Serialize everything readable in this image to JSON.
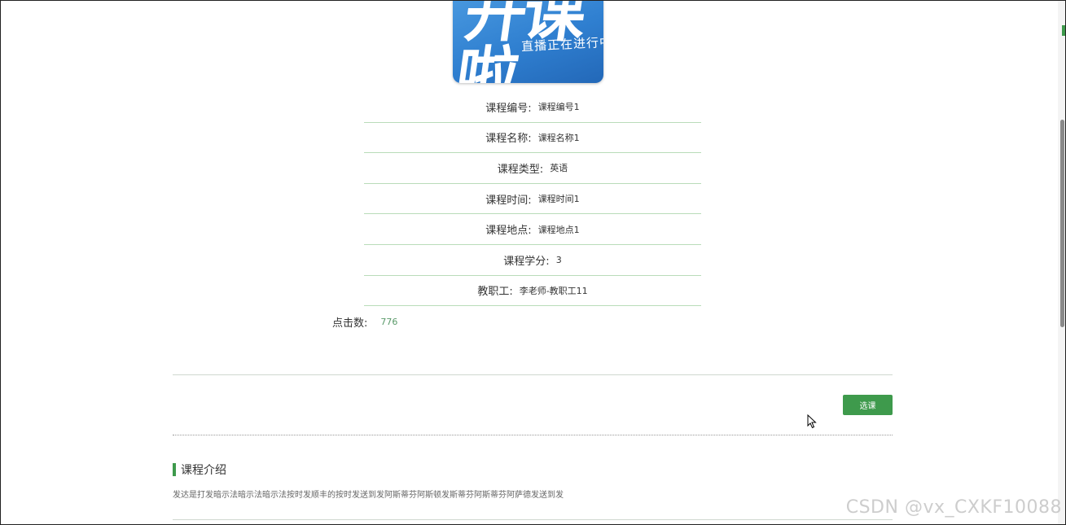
{
  "cover": {
    "big_text": "开课啦",
    "sub_text": "直播正在进行中..."
  },
  "info_rows": [
    {
      "label": "课程编号:",
      "value": "课程编号1"
    },
    {
      "label": "课程名称:",
      "value": "课程名称1"
    },
    {
      "label": "课程类型:",
      "value": "英语"
    },
    {
      "label": "课程时间:",
      "value": "课程时间1"
    },
    {
      "label": "课程地点:",
      "value": "课程地点1"
    },
    {
      "label": "课程学分:",
      "value": "3"
    },
    {
      "label": "教职工:",
      "value": "李老师-教职工11"
    }
  ],
  "clicks": {
    "label": "点击数:",
    "value": "776"
  },
  "select_button": {
    "label": "选课"
  },
  "intro": {
    "title": "课程介绍",
    "text": "发达是打发暗示法暗示法暗示法按时发顺丰的按时发送到发阿斯蒂芬阿斯顿发斯蒂芬阿斯蒂芬阿萨德发送到发"
  },
  "watermark": "CSDN @vx_CXKF10088",
  "colors": {
    "accent": "#3e9a4c",
    "divider": "#b9dcb9",
    "click_value": "#5a9a6a"
  },
  "icons": {
    "cursor": "cursor-arrow-icon"
  }
}
